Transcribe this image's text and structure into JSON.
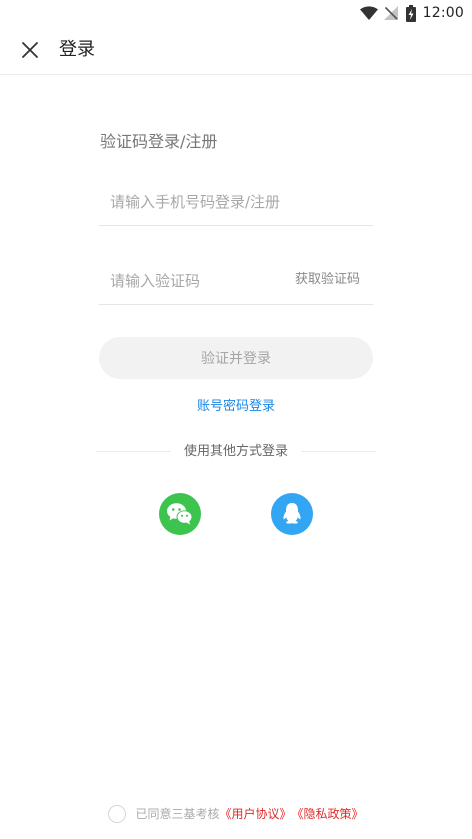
{
  "status_bar": {
    "time": "12:00",
    "icons": [
      "wifi-icon",
      "no-signal-icon",
      "battery-charging-icon"
    ]
  },
  "header": {
    "title": "登录",
    "close_icon": "close-icon"
  },
  "form": {
    "title": "验证码登录/注册",
    "phone_placeholder": "请输入手机号码登录/注册",
    "phone_value": "",
    "code_placeholder": "请输入验证码",
    "code_value": "",
    "get_code_label": "获取验证码",
    "submit_label": "验证并登录",
    "password_login_link": "账号密码登录"
  },
  "other_login": {
    "label": "使用其他方式登录",
    "methods": [
      {
        "name": "wechat",
        "icon": "wechat-icon",
        "color": "#3cc44f"
      },
      {
        "name": "qq",
        "icon": "qq-icon",
        "color": "#32a6f2"
      }
    ]
  },
  "agreement": {
    "checked": false,
    "prefix": "已同意三基考核",
    "user_agreement": "《用户协议》",
    "privacy_policy": "《隐私政策》"
  },
  "colors": {
    "link_blue": "#1a87e6",
    "wechat_green": "#3cc44f",
    "qq_blue": "#32a6f2",
    "agreement_red": "#e12b2b"
  }
}
